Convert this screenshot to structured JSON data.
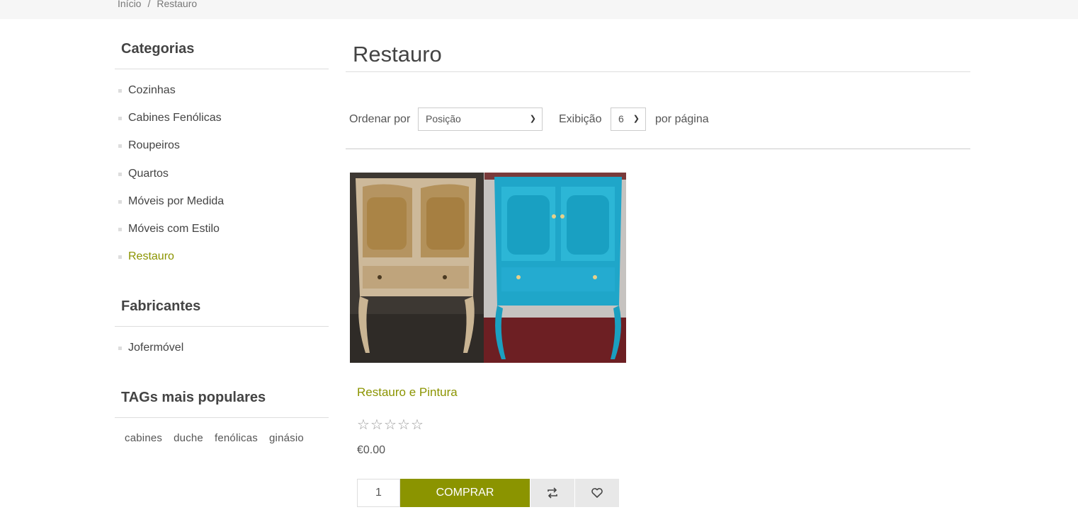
{
  "breadcrumb": {
    "home": "Início",
    "separator": "/",
    "current": "Restauro"
  },
  "sidebar": {
    "categories": {
      "title": "Categorias",
      "items": [
        "Cozinhas",
        "Cabines Fenólicas",
        "Roupeiros",
        "Quartos",
        "Móveis por Medida",
        "Móveis com Estilo",
        "Restauro"
      ],
      "active_item": "Restauro"
    },
    "manufacturers": {
      "title": "Fabricantes",
      "items": [
        "Jofermóvel"
      ]
    },
    "tags": {
      "title": "TAGs mais populares",
      "items": [
        "cabines",
        "duche",
        "fenólicas",
        "ginásio"
      ]
    }
  },
  "main": {
    "title": "Restauro",
    "toolbar": {
      "sort_label": "Ordenar por",
      "sort_value": "Posição",
      "view_label": "Exibição",
      "page_size_value": "6",
      "per_page_label": "por página"
    },
    "product": {
      "name": "Restauro e Pintura",
      "rating_stars": 0,
      "rating_max": 5,
      "price": "€0.00",
      "quantity": "1",
      "buy_label": "COMPRAR",
      "compare_icon": "compare-arrows-icon",
      "wishlist_icon": "heart-icon"
    }
  },
  "colors": {
    "accent": "#8b9400",
    "text": "#444444",
    "divider": "#dddddd",
    "icon_button_bg": "#e8e8e8"
  }
}
